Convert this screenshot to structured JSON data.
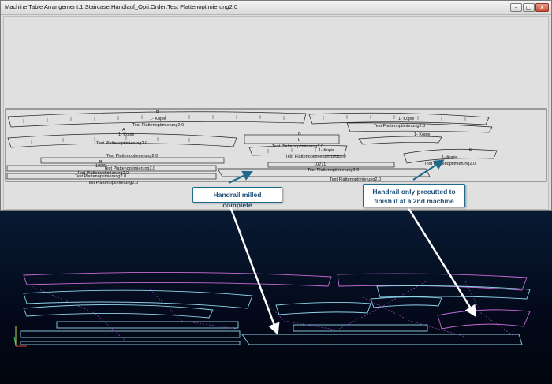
{
  "window": {
    "title": "Machine Table Arrangement:1,Staircase:Handlauf_Opti,Order:Test Plattenoptimierung2.0",
    "min_glyph": "–",
    "max_glyph": "□",
    "close_glyph": "✕"
  },
  "layout_labels": {
    "b1": "B",
    "b1_kopie": "1- Kopie",
    "part_a": "Test Plattenoptimierung2.0",
    "a_mark": "A",
    "a_kopie": "1- Kopie",
    "part_b": "Test Plattenoptimierung2.0",
    "part_c": "Test Plattenoptimierung2.0",
    "b2": "B",
    "num1": "10271",
    "part_d": "Test Plattenoptimierung2.0",
    "part_e": "Test Plattenoptimierung2.0",
    "part_f": "Test Plattenoptimierung2.0",
    "part_g": "Test Plattenoptimierung2.0",
    "right_kopie": "1- Kopie",
    "right_part1": "Test Plattenoptimierung2.0",
    "right_kopie2": "1- Kopie",
    "mid_b": "B",
    "mid_l": "L",
    "mid_part1": "Test Plattenoptimierung2.0",
    "mid_kopie": "1- Kopie",
    "mid_part2": "Test PlattenoptimierungDruc2.0",
    "mid_num": "10271",
    "mid_part3": "Test Plattenoptimierung2.0",
    "mid_part4": "Test Plattenoptimierung2.0",
    "bottom_part": "Test Plattenoptimierung2.0",
    "far_f": "F",
    "far_kopie": "1- Kopie",
    "far_part": "Test Plattenoptimierung2.0"
  },
  "callouts": {
    "milled": "Handrail milled complete",
    "precut_line1": "Handrail only precutted to",
    "precut_line2": "finish it at a 2nd machine"
  }
}
